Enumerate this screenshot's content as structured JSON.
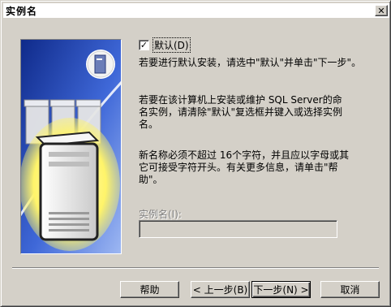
{
  "window": {
    "title": "实例名",
    "close_glyph": "✕"
  },
  "default_checkbox": {
    "checked": true,
    "check_glyph": "✓",
    "label": "默认(D)"
  },
  "paragraphs": {
    "p1": "若要进行默认安装，请选中\"默认\"并单击\"下一步\"。",
    "p2": "若要在该计算机上安装或维护 SQL Server的命名实例，请清除\"默认\"复选框并键入或选择实例名。",
    "p3": "新名称必须不超过 16个字符，并且应以字母或其它可接受字符开头。有关更多信息，请单击\"帮助\"。"
  },
  "instance_name": {
    "label": "实例名(I):",
    "value": "",
    "enabled": false
  },
  "buttons": {
    "help": "帮助",
    "back": "< 上一步(B)",
    "next": "下一步(N) >",
    "cancel": "取消"
  },
  "icons": {
    "art": "server-tower-illustration",
    "small_server": "server-icon"
  },
  "colors": {
    "dialog_bg": "#d4d0c8",
    "art_blue": "#1a3a9e",
    "art_glow": "#fff46a"
  }
}
